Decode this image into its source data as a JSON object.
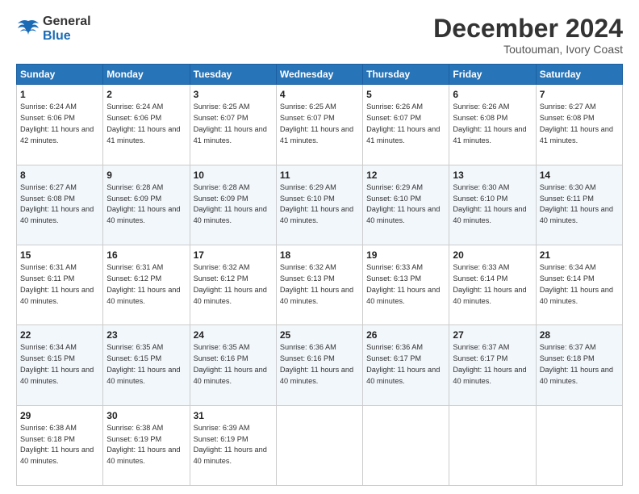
{
  "logo": {
    "general": "General",
    "blue": "Blue"
  },
  "header": {
    "month_title": "December 2024",
    "location": "Toutouman, Ivory Coast"
  },
  "days_of_week": [
    "Sunday",
    "Monday",
    "Tuesday",
    "Wednesday",
    "Thursday",
    "Friday",
    "Saturday"
  ],
  "weeks": [
    [
      {
        "day": "1",
        "sunrise": "6:24 AM",
        "sunset": "6:06 PM",
        "daylight": "11 hours and 42 minutes."
      },
      {
        "day": "2",
        "sunrise": "6:24 AM",
        "sunset": "6:06 PM",
        "daylight": "11 hours and 41 minutes."
      },
      {
        "day": "3",
        "sunrise": "6:25 AM",
        "sunset": "6:07 PM",
        "daylight": "11 hours and 41 minutes."
      },
      {
        "day": "4",
        "sunrise": "6:25 AM",
        "sunset": "6:07 PM",
        "daylight": "11 hours and 41 minutes."
      },
      {
        "day": "5",
        "sunrise": "6:26 AM",
        "sunset": "6:07 PM",
        "daylight": "11 hours and 41 minutes."
      },
      {
        "day": "6",
        "sunrise": "6:26 AM",
        "sunset": "6:08 PM",
        "daylight": "11 hours and 41 minutes."
      },
      {
        "day": "7",
        "sunrise": "6:27 AM",
        "sunset": "6:08 PM",
        "daylight": "11 hours and 41 minutes."
      }
    ],
    [
      {
        "day": "8",
        "sunrise": "6:27 AM",
        "sunset": "6:08 PM",
        "daylight": "11 hours and 40 minutes."
      },
      {
        "day": "9",
        "sunrise": "6:28 AM",
        "sunset": "6:09 PM",
        "daylight": "11 hours and 40 minutes."
      },
      {
        "day": "10",
        "sunrise": "6:28 AM",
        "sunset": "6:09 PM",
        "daylight": "11 hours and 40 minutes."
      },
      {
        "day": "11",
        "sunrise": "6:29 AM",
        "sunset": "6:10 PM",
        "daylight": "11 hours and 40 minutes."
      },
      {
        "day": "12",
        "sunrise": "6:29 AM",
        "sunset": "6:10 PM",
        "daylight": "11 hours and 40 minutes."
      },
      {
        "day": "13",
        "sunrise": "6:30 AM",
        "sunset": "6:10 PM",
        "daylight": "11 hours and 40 minutes."
      },
      {
        "day": "14",
        "sunrise": "6:30 AM",
        "sunset": "6:11 PM",
        "daylight": "11 hours and 40 minutes."
      }
    ],
    [
      {
        "day": "15",
        "sunrise": "6:31 AM",
        "sunset": "6:11 PM",
        "daylight": "11 hours and 40 minutes."
      },
      {
        "day": "16",
        "sunrise": "6:31 AM",
        "sunset": "6:12 PM",
        "daylight": "11 hours and 40 minutes."
      },
      {
        "day": "17",
        "sunrise": "6:32 AM",
        "sunset": "6:12 PM",
        "daylight": "11 hours and 40 minutes."
      },
      {
        "day": "18",
        "sunrise": "6:32 AM",
        "sunset": "6:13 PM",
        "daylight": "11 hours and 40 minutes."
      },
      {
        "day": "19",
        "sunrise": "6:33 AM",
        "sunset": "6:13 PM",
        "daylight": "11 hours and 40 minutes."
      },
      {
        "day": "20",
        "sunrise": "6:33 AM",
        "sunset": "6:14 PM",
        "daylight": "11 hours and 40 minutes."
      },
      {
        "day": "21",
        "sunrise": "6:34 AM",
        "sunset": "6:14 PM",
        "daylight": "11 hours and 40 minutes."
      }
    ],
    [
      {
        "day": "22",
        "sunrise": "6:34 AM",
        "sunset": "6:15 PM",
        "daylight": "11 hours and 40 minutes."
      },
      {
        "day": "23",
        "sunrise": "6:35 AM",
        "sunset": "6:15 PM",
        "daylight": "11 hours and 40 minutes."
      },
      {
        "day": "24",
        "sunrise": "6:35 AM",
        "sunset": "6:16 PM",
        "daylight": "11 hours and 40 minutes."
      },
      {
        "day": "25",
        "sunrise": "6:36 AM",
        "sunset": "6:16 PM",
        "daylight": "11 hours and 40 minutes."
      },
      {
        "day": "26",
        "sunrise": "6:36 AM",
        "sunset": "6:17 PM",
        "daylight": "11 hours and 40 minutes."
      },
      {
        "day": "27",
        "sunrise": "6:37 AM",
        "sunset": "6:17 PM",
        "daylight": "11 hours and 40 minutes."
      },
      {
        "day": "28",
        "sunrise": "6:37 AM",
        "sunset": "6:18 PM",
        "daylight": "11 hours and 40 minutes."
      }
    ],
    [
      {
        "day": "29",
        "sunrise": "6:38 AM",
        "sunset": "6:18 PM",
        "daylight": "11 hours and 40 minutes."
      },
      {
        "day": "30",
        "sunrise": "6:38 AM",
        "sunset": "6:19 PM",
        "daylight": "11 hours and 40 minutes."
      },
      {
        "day": "31",
        "sunrise": "6:39 AM",
        "sunset": "6:19 PM",
        "daylight": "11 hours and 40 minutes."
      },
      null,
      null,
      null,
      null
    ]
  ]
}
